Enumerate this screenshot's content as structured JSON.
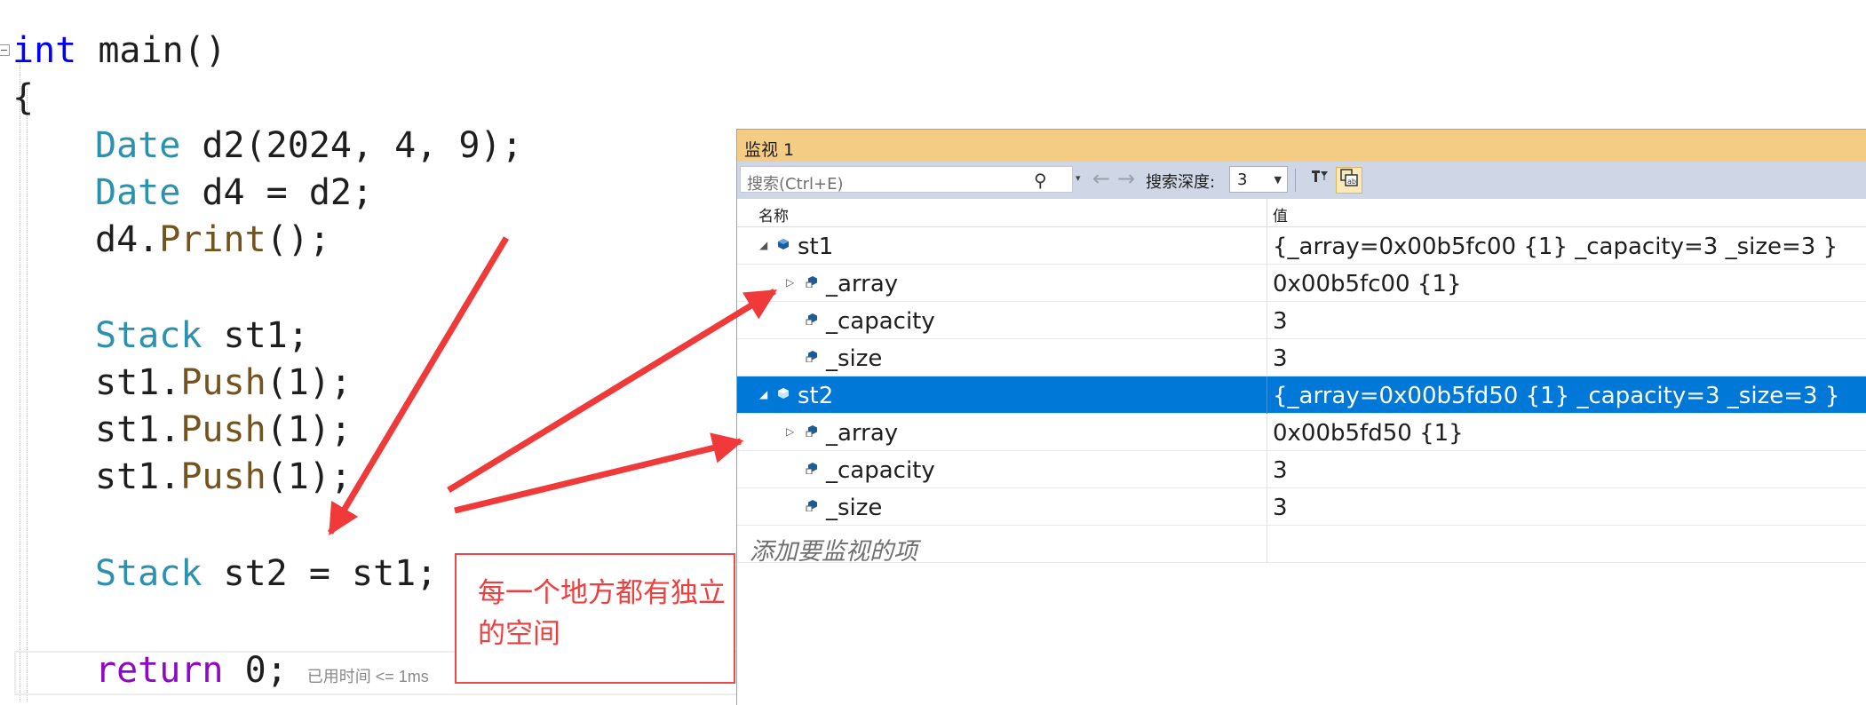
{
  "code": {
    "lines": [
      {
        "parts": [
          "int",
          " main()"
        ]
      },
      {
        "text": "{"
      },
      {
        "parts": [
          "Date",
          " d2(2024, 4, 9);"
        ]
      },
      {
        "parts": [
          "Date",
          " d4 = d2;"
        ]
      },
      {
        "parts": [
          "d4.",
          "Print",
          "();"
        ]
      },
      {
        "parts": [
          "Stack",
          " st1;"
        ]
      },
      {
        "parts": [
          "st1.",
          "Push",
          "(1);"
        ]
      },
      {
        "parts": [
          "st1.",
          "Push",
          "(1);"
        ]
      },
      {
        "parts": [
          "st1.",
          "Push",
          "(1);"
        ]
      },
      {
        "parts": [
          "Stack",
          " st2 = st1;"
        ]
      },
      {
        "parts": [
          "return",
          " 0;"
        ]
      }
    ],
    "elapsed_hint": "已用时间 <= 1ms"
  },
  "callout": {
    "text": "每一个地方都有独立的空间",
    "color": "#ef3e3e"
  },
  "watch": {
    "title": "监视 1",
    "search_placeholder": "搜索(Ctrl+E)",
    "depth_label": "搜索深度:",
    "depth_value": "3",
    "columns": {
      "name": "名称",
      "value": "值"
    },
    "rows": [
      {
        "name": "st1",
        "value": "{_array=0x00b5fc00 {1} _capacity=3 _size=3 }",
        "expander": "expanded",
        "level": 0
      },
      {
        "name": "_array",
        "value": "0x00b5fc00 {1}",
        "expander": "collapsed",
        "level": 1
      },
      {
        "name": "_capacity",
        "value": "3",
        "expander": "none",
        "level": 1
      },
      {
        "name": "_size",
        "value": "3",
        "expander": "none",
        "level": 1
      },
      {
        "name": "st2",
        "value": "{_array=0x00b5fd50 {1} _capacity=3 _size=3 }",
        "expander": "expanded",
        "level": 0,
        "selected": true
      },
      {
        "name": "_array",
        "value": "0x00b5fd50 {1}",
        "expander": "collapsed",
        "level": 1
      },
      {
        "name": "_capacity",
        "value": "3",
        "expander": "none",
        "level": 1
      },
      {
        "name": "_size",
        "value": "3",
        "expander": "none",
        "level": 1
      }
    ],
    "add_item_placeholder": "添加要监视的项",
    "colors": {
      "title_bar": "#f5cc84",
      "toolbar": "#cfd6e5",
      "selection": "#0078d7"
    }
  },
  "annotation_color": "#f03a3a"
}
